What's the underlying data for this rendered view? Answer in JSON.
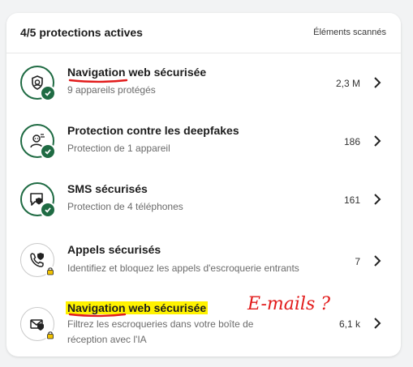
{
  "header": {
    "title": "4/5 protections actives",
    "right_label": "Éléments scannés"
  },
  "rows": [
    {
      "title": "Navigation web sécurisée",
      "subtitle": "9 appareils protégés",
      "count": "2,3 M",
      "icon": "shield-face-icon",
      "active": true
    },
    {
      "title": "Protection contre les deepfakes",
      "subtitle": "Protection de 1 appareil",
      "count": "186",
      "icon": "deepfake-face-icon",
      "active": true
    },
    {
      "title": "SMS sécurisés",
      "subtitle": "Protection de 4 téléphones",
      "count": "161",
      "icon": "message-shield-icon",
      "active": true
    },
    {
      "title": "Appels sécurisés",
      "subtitle": "Identifiez et bloquez les appels d'escroquerie entrants",
      "count": "7",
      "icon": "phone-shield-icon",
      "active": false
    },
    {
      "title": "Navigation web sécurisée",
      "subtitle_line1": "Filtrez les escroqueries dans votre boîte de",
      "subtitle_line2": "réception avec l'IA",
      "count": "6,1 k",
      "icon": "mail-shield-icon",
      "active": false
    }
  ],
  "annotation": {
    "handwritten_text": "E-mails ?"
  },
  "colors": {
    "active_green": "#1f6b43",
    "annotation_red": "#e21b1b",
    "highlight_yellow": "#fff200",
    "lock_yellow": "#f2c200"
  }
}
